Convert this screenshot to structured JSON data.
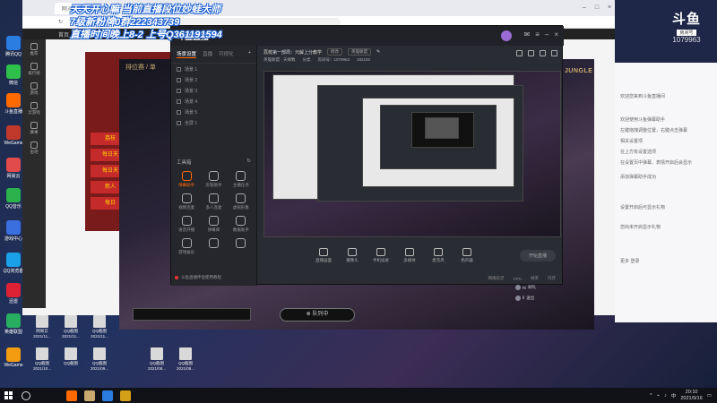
{
  "overlay": {
    "line1": "天天开心嘛 当前直播段位妙蛙大师",
    "line2": "7级新粉牌0群222343739",
    "line3": "直播时间晚上8-2 上号Q361191594"
  },
  "browser": {
    "tab_title": "阿斗…",
    "nav_home": "首页",
    "left_items": [
      "推荐",
      "排行榜",
      "游戏",
      "云游戏",
      "赛事",
      "鱼吧"
    ],
    "banner_text": [
      "荔枝",
      "每日天",
      "每日天",
      "新人",
      "每日"
    ]
  },
  "overlay_lol": {
    "rank_label": "排位赛 / 单",
    "jungle": "JUNGLE",
    "queue_label": "队列中"
  },
  "broadcaster": {
    "logo": "斗鱼直播",
    "tabs": [
      "场景设置",
      "直播",
      "可视化"
    ],
    "scenes": [
      "场景 1",
      "场景 2",
      "场景 3",
      "场景 4",
      "场景 5",
      "全屏 1"
    ],
    "tools_header": "工具箱",
    "tools": [
      {
        "label": "弹幕助手",
        "active": true
      },
      {
        "label": "房管助手",
        "active": false
      },
      {
        "label": "主播任务",
        "active": false
      },
      {
        "label": "视频连麦",
        "active": false
      },
      {
        "label": "多人连麦",
        "active": false
      },
      {
        "label": "虚拟形象",
        "active": false
      },
      {
        "label": "语音开播",
        "active": false
      },
      {
        "label": "弹幕库",
        "active": false
      },
      {
        "label": "数据助手",
        "active": false
      },
      {
        "label": "游戏娱乐",
        "active": false
      },
      {
        "label": "",
        "active": false
      },
      {
        "label": "",
        "active": false
      }
    ],
    "warn_text": "斗鱼直播伴侣使用教程",
    "room_title": "荔枝第一部周：元解上分教学",
    "chip_edit": "修改",
    "chip_category": "英雄联盟",
    "sub_room": "房间号：1079963",
    "sub_fans": "182192",
    "sub_type": "英雄联盟 · 天梯数",
    "sub_cat": "分类",
    "bottom_buttons": [
      "直播画面",
      "摄像头",
      "手机投屏",
      "多媒体",
      "麦克风",
      "扬声器"
    ],
    "start_label": "开始直播",
    "status_items": [
      "网络延迟",
      "CPU",
      "帧率",
      "内存"
    ]
  },
  "douyu": {
    "brand_logo": "斗鱼",
    "brand_sub": "房间号",
    "room_number": "1079963",
    "messages": [
      "欢迎您来到斗鱼直播间",
      "欢迎使用斗鱼弹幕助手",
      "左键拖拽调整位置，右键点击弹幕",
      "相关设置项",
      "在上方有设置选项",
      "在设置页中弹幕、表情开启后会显示",
      "添加弹幕助手成功",
      "设置开启后可显示礼物",
      "您尚未开启显示礼物"
    ],
    "footer": "更多 登录"
  },
  "chat": [
    {
      "name": "Ri",
      "text": "刷礼"
    },
    {
      "name": "Ⅱ",
      "text": "送出"
    }
  ],
  "desktop_left": [
    "腾讯QQ",
    "微信",
    "斗鱼直播",
    "WeGame",
    "网易云",
    "QQ音乐",
    "游戏中心",
    "QQ浏览器",
    "迅雷",
    "英雄联盟",
    "WeGame"
  ],
  "desktop_bottom": [
    {
      "label": "网易云",
      "sub": "2021/11..."
    },
    {
      "label": "QQ截图",
      "sub": "2021/11..."
    },
    {
      "label": "QQ截图",
      "sub": "2021/11..."
    },
    {
      "label": "QQ截图",
      "sub": "2021/10..."
    },
    {
      "label": "QQ截图",
      "sub": ""
    },
    {
      "label": "QQ截图",
      "sub": "2021/09..."
    },
    {
      "label": "QQ截图",
      "sub": "2021/08..."
    },
    {
      "label": "QQ截图",
      "sub": "2021/08..."
    }
  ],
  "taskbar": {
    "time": "20:10",
    "date": "2021/9/16",
    "lang": "中"
  }
}
